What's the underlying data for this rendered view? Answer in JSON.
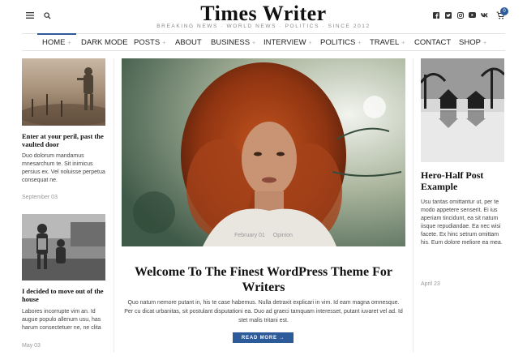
{
  "header": {
    "logo": "Times Writer",
    "tagline": "BREAKING NEWS · WORLD NEWS · POLITICS · SINCE 2012",
    "cart_count": "0"
  },
  "icons": {
    "menu": "hamburger-icon",
    "search": "search-icon",
    "social": [
      "facebook-icon",
      "twitter-icon",
      "instagram-icon",
      "youtube-icon",
      "vk-icon"
    ],
    "cart": "cart-icon"
  },
  "nav": {
    "items": [
      {
        "label": "HOME",
        "plus": "+",
        "active": true
      },
      {
        "label": "DARK MODE",
        "plus": ""
      },
      {
        "label": "POSTS",
        "plus": "+"
      },
      {
        "label": "ABOUT",
        "plus": ""
      },
      {
        "label": "BUSINESS",
        "plus": "+"
      },
      {
        "label": "INTERVIEW",
        "plus": "+"
      },
      {
        "label": "POLITICS",
        "plus": "+"
      },
      {
        "label": "TRAVEL",
        "plus": "+"
      },
      {
        "label": "CONTACT",
        "plus": ""
      },
      {
        "label": "SHOP",
        "plus": "+"
      }
    ]
  },
  "left_posts": [
    {
      "title": "Enter at your peril, past the vaulted door",
      "excerpt": "Duo dolorum mandamus mnesarchum te. Sit inimicus persius ex. Vel noluisse perpetua consequat ne.",
      "date": "September 03"
    },
    {
      "title": "I decided to move out of the house",
      "excerpt": "Labores incorrupte vim an. Id augue populo allenum usu, has harum consectetuer ne, ne clita",
      "date": "May 03"
    }
  ],
  "featured": {
    "date": "February 01",
    "category": "Opinion",
    "title": "Welcome To The Finest WordPress Theme For Writers",
    "excerpt": "Quo natum nemore putant in, his te case habemus. Nulla detraxit explicari in vim. Id eam magna omnesque. Per cu dicat urbanitas, sit postulant disputationi ea. Duo ad graeci tamquam interesset, putant iuvaret vel ad. Id stet malis tritani est.",
    "button": "READ MORE →"
  },
  "right_post": {
    "title": "Hero-Half Post Example",
    "excerpt": "Usu tantas omittantur ut, per te modo appetere senserit. Ei ius aperiam tincidunt, ea sit natum iisque repudiandae. Ea nec wisi facete. Ex hinc setrum omittam his. Eum dolore meliore ea mea.",
    "date": "April 23"
  },
  "colors": {
    "accent": "#2d5b9a"
  }
}
